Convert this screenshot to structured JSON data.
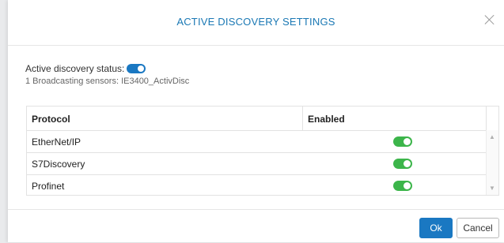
{
  "dialog": {
    "title": "ACTIVE DISCOVERY SETTINGS",
    "close_icon": "close-icon"
  },
  "status": {
    "label": "Active discovery status:",
    "enabled": true,
    "broadcasting": "1 Broadcasting sensors: IE3400_ActivDisc"
  },
  "table": {
    "headers": [
      "Protocol",
      "Enabled"
    ],
    "rows": [
      {
        "protocol": "EtherNet/IP",
        "enabled": true
      },
      {
        "protocol": "S7Discovery",
        "enabled": true
      },
      {
        "protocol": "Profinet",
        "enabled": true
      }
    ]
  },
  "footer": {
    "ok_label": "Ok",
    "cancel_label": "Cancel"
  },
  "colors": {
    "accent": "#1a78c2",
    "toggle_on": "#3cb54a",
    "title": "#1a78b4"
  }
}
